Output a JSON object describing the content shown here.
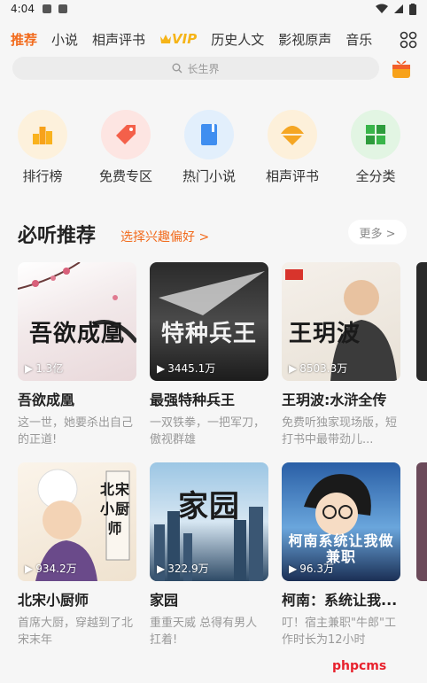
{
  "status": {
    "time": "4:04"
  },
  "tabs": [
    {
      "label": "推荐"
    },
    {
      "label": "小说"
    },
    {
      "label": "相声评书"
    },
    {
      "label": "VIP"
    },
    {
      "label": "历史人文"
    },
    {
      "label": "影视原声"
    },
    {
      "label": "音乐"
    }
  ],
  "search": {
    "placeholder": "长生界"
  },
  "categories": [
    {
      "label": "排行榜",
      "icon": "trophy-icon",
      "color": "#f9b21d",
      "bg": "#fdf1dc"
    },
    {
      "label": "免费专区",
      "icon": "tag-icon",
      "color": "#f4604a",
      "bg": "#fde5e2"
    },
    {
      "label": "热门小说",
      "icon": "book-icon",
      "color": "#3f8ef0",
      "bg": "#e2effc"
    },
    {
      "label": "相声评书",
      "icon": "crosstalk-icon",
      "color": "#f5a623",
      "bg": "#fdf0da"
    },
    {
      "label": "全分类",
      "icon": "grid-icon",
      "color": "#39b54a",
      "bg": "#e2f5e3"
    }
  ],
  "section": {
    "title": "必听推荐",
    "link": "选择兴趣偏好 >",
    "more": "更多 >"
  },
  "books": [
    {
      "title": "吾欲成凰",
      "desc": "这一世，她要杀出自己的正道!",
      "plays": "1.3亿",
      "cover_text": "吾欲成凰"
    },
    {
      "title": "最强特种兵王",
      "desc": "一双铁拳，一把军刀，傲视群雄",
      "plays": "3445.1万",
      "cover_text": "特种兵王"
    },
    {
      "title": "王玥波:水浒全传",
      "desc": "免费听独家现场版，短打书中最带劲儿...",
      "plays": "8503.3万",
      "cover_text": "王玥波"
    },
    {
      "title": "北宋小厨师",
      "desc": "首席大厨，穿越到了北宋末年",
      "plays": "934.2万",
      "cover_text": "北宋小厨师"
    },
    {
      "title": "家园",
      "desc": "重重天威 总得有男人扛着!",
      "plays": "322.9万",
      "cover_text": "家园"
    },
    {
      "title": "柯南：系统让我...",
      "desc": "叮！宿主兼职\"牛郎\"工作时长为12小时",
      "plays": "96.3万",
      "cover_text": "柯南系统让我做兼职"
    }
  ],
  "watermark": "phpcms"
}
